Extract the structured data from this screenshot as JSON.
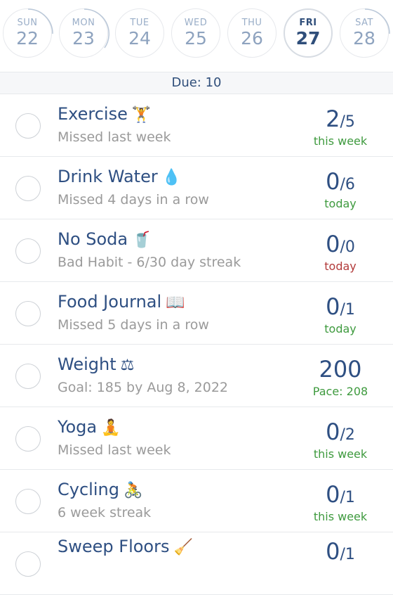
{
  "week": {
    "days": [
      {
        "name": "SUN",
        "num": "22"
      },
      {
        "name": "MON",
        "num": "23"
      },
      {
        "name": "TUE",
        "num": "24"
      },
      {
        "name": "WED",
        "num": "25"
      },
      {
        "name": "THU",
        "num": "26"
      },
      {
        "name": "FRI",
        "num": "27"
      },
      {
        "name": "SAT",
        "num": "28"
      }
    ],
    "selected_index": 5
  },
  "due_label": "Due: 10",
  "habits": [
    {
      "title": "Exercise",
      "emoji": "🏋",
      "subtitle": "Missed last week",
      "count": "2",
      "total": "/5",
      "period": "this week",
      "period_color": "green"
    },
    {
      "title": "Drink Water",
      "emoji": "💧",
      "subtitle": "Missed 4 days in a row",
      "count": "0",
      "total": "/6",
      "period": "today",
      "period_color": "green"
    },
    {
      "title": "No Soda",
      "emoji": "🥤",
      "subtitle": "Bad Habit - 6/30 day streak",
      "count": "0",
      "total": "/0",
      "period": "today",
      "period_color": "red"
    },
    {
      "title": "Food Journal",
      "emoji": "📖",
      "subtitle": "Missed 5 days in a row",
      "count": "0",
      "total": "/1",
      "period": "today",
      "period_color": "green"
    },
    {
      "title": "Weight",
      "emoji": "⚖",
      "subtitle": "Goal: 185 by Aug 8, 2022",
      "count": "200",
      "total": "",
      "period": "Pace: 208",
      "period_color": "green"
    },
    {
      "title": "Yoga",
      "emoji": "🧘",
      "subtitle": "Missed last week",
      "count": "0",
      "total": "/2",
      "period": "this week",
      "period_color": "green"
    },
    {
      "title": "Cycling",
      "emoji": "🚴",
      "subtitle": "6 week streak",
      "count": "0",
      "total": "/1",
      "period": "this week",
      "period_color": "green"
    },
    {
      "title": "Sweep Floors",
      "emoji": "🧹",
      "subtitle": "",
      "count": "0",
      "total": "/1",
      "period": "",
      "period_color": "green"
    }
  ],
  "colors": {
    "accent": "#2e4f82",
    "green": "#3e9a3e",
    "red": "#b23a3a",
    "muted": "#9a9a9a"
  }
}
